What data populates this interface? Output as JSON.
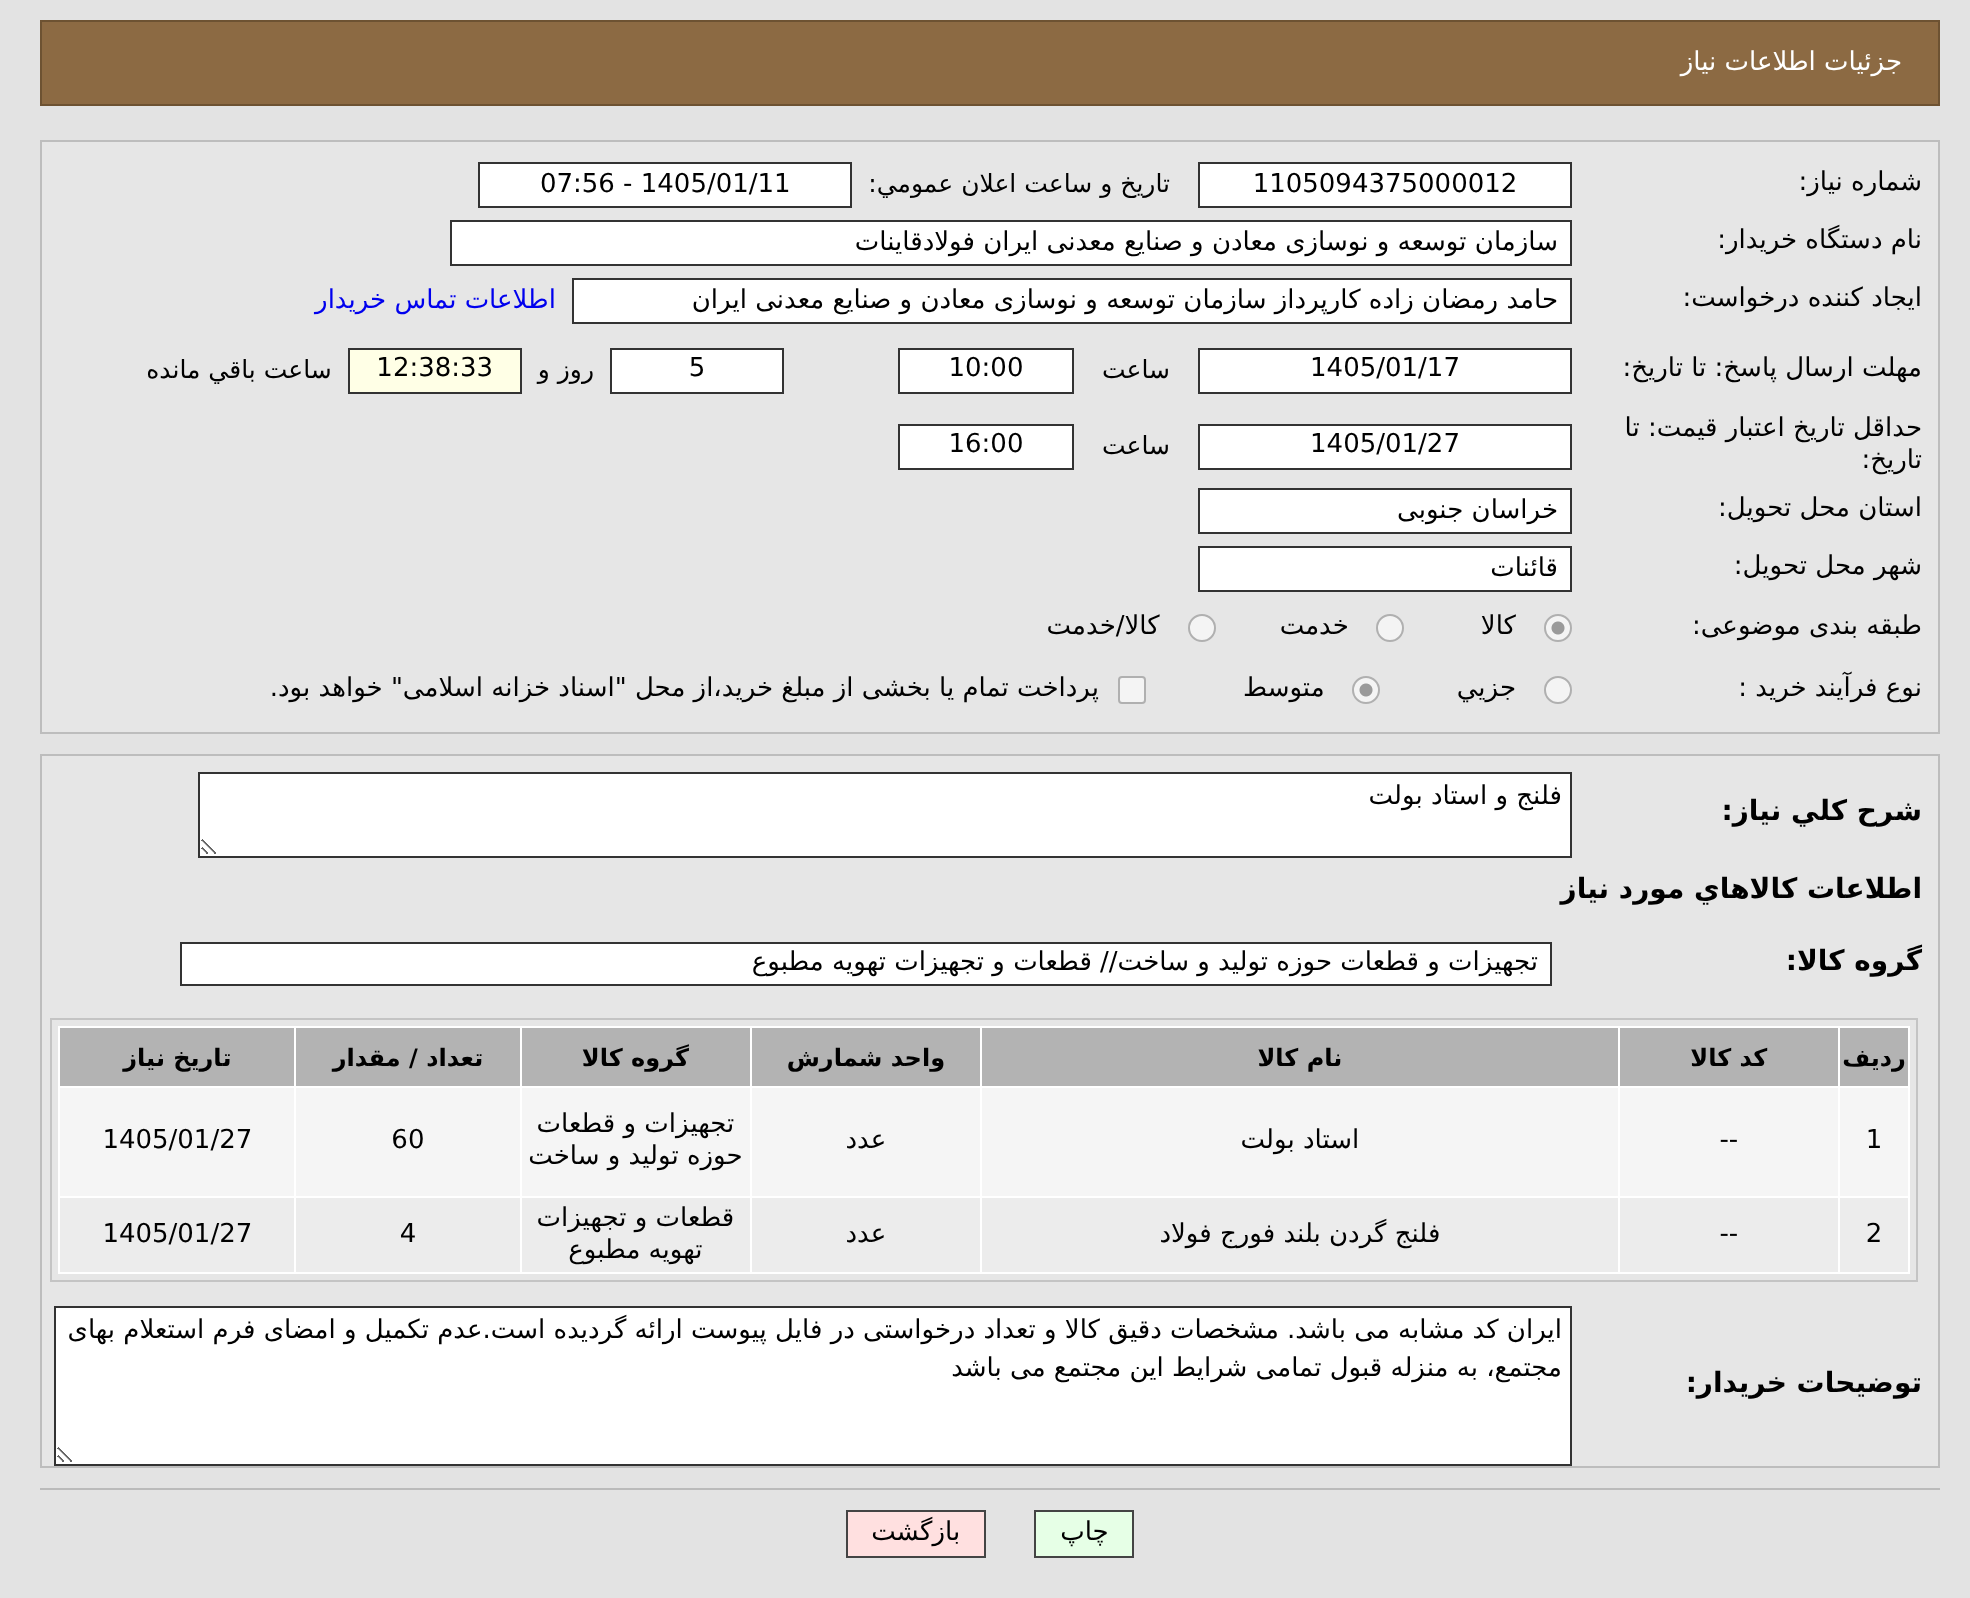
{
  "header": {
    "title": "جزئیات اطلاعات نیاز"
  },
  "need_number": {
    "label": "شماره نیاز:",
    "value": "1105094375000012"
  },
  "announce": {
    "label": "تاريخ و ساعت اعلان عمومي:",
    "value": "1405/01/11 - 07:56"
  },
  "buyer": {
    "label": "نام دستگاه خريدار:",
    "value": "سازمان توسعه و نوسازی معادن و صنایع معدنی ایران فولادقاینات"
  },
  "creator": {
    "label": "ايجاد کننده درخواست:",
    "value": "حامد  رمضان زاده  کارپرداز  سازمان توسعه و نوسازی معادن و صنایع معدنی ایران",
    "link": "اطلاعات تماس خريدار"
  },
  "deadline": {
    "label": "مهلت ارسال پاسخ: تا تاریخ:",
    "date": "1405/01/17",
    "time_label": "ساعت",
    "time": "10:00",
    "days": "5",
    "days_label": "روز و",
    "remaining": "12:38:33",
    "remaining_label": "ساعت باقي مانده"
  },
  "validity": {
    "label": "حداقل تاريخ اعتبار قيمت: تا تاریخ:",
    "date": "1405/01/27",
    "time_label": "ساعت",
    "time": "16:00"
  },
  "province": {
    "label": "استان محل تحويل:",
    "value": "خراسان جنوبی"
  },
  "city": {
    "label": "شهر محل تحويل:",
    "value": "قائنات"
  },
  "category": {
    "label": "طبقه بندی موضوعی:",
    "options": [
      {
        "label": "کالا",
        "selected": true
      },
      {
        "label": "خدمت",
        "selected": false
      },
      {
        "label": "کالا/خدمت",
        "selected": false
      }
    ]
  },
  "process": {
    "label": "نوع فرآیند خرید :",
    "options": [
      {
        "label": "جزيي",
        "selected": false
      },
      {
        "label": "متوسط",
        "selected": true
      }
    ],
    "treasury": {
      "label": "پرداخت تمام یا بخشی از مبلغ خرید،از محل \"اسناد خزانه اسلامی\" خواهد بود.",
      "checked": false
    }
  },
  "description": {
    "label": "شرح کلي نياز:",
    "value": "فلنج و استاد بولت"
  },
  "goods_heading": "اطلاعات کالاهاي مورد نياز",
  "goods_group": {
    "label": "گروه کالا:",
    "value": "تجهیزات و قطعات حوزه تولید و ساخت//  قطعات و تجهیزات تهویه مطبوع"
  },
  "table": {
    "columns": [
      "ردیف",
      "کد کالا",
      "نام کالا",
      "واحد شمارش",
      "گروه کالا",
      "تعداد / مقدار",
      "تاریخ نیاز"
    ],
    "rows": [
      [
        "1",
        "--",
        "استاد بولت",
        "عدد",
        "تجهیزات و قطعات حوزه تولید و ساخت",
        "60",
        "1405/01/27"
      ],
      [
        "2",
        "--",
        "فلنج گردن بلند فورج فولاد",
        "عدد",
        "قطعات و تجهیزات تهویه مطبوع",
        "4",
        "1405/01/27"
      ]
    ]
  },
  "notes": {
    "label": "توضیحات خریدار:",
    "value": "ایران کد مشابه می باشد. مشخصات دقیق کالا و تعداد درخواستی در فایل پیوست ارائه گردیده است.عدم تکمیل و امضای فرم استعلام بهای مجتمع، به منزله قبول تمامی شرایط این مجتمع می باشد"
  },
  "buttons": [
    {
      "label": "چاپ",
      "kind": "print"
    },
    {
      "label": "بازگشت",
      "kind": "back"
    }
  ]
}
